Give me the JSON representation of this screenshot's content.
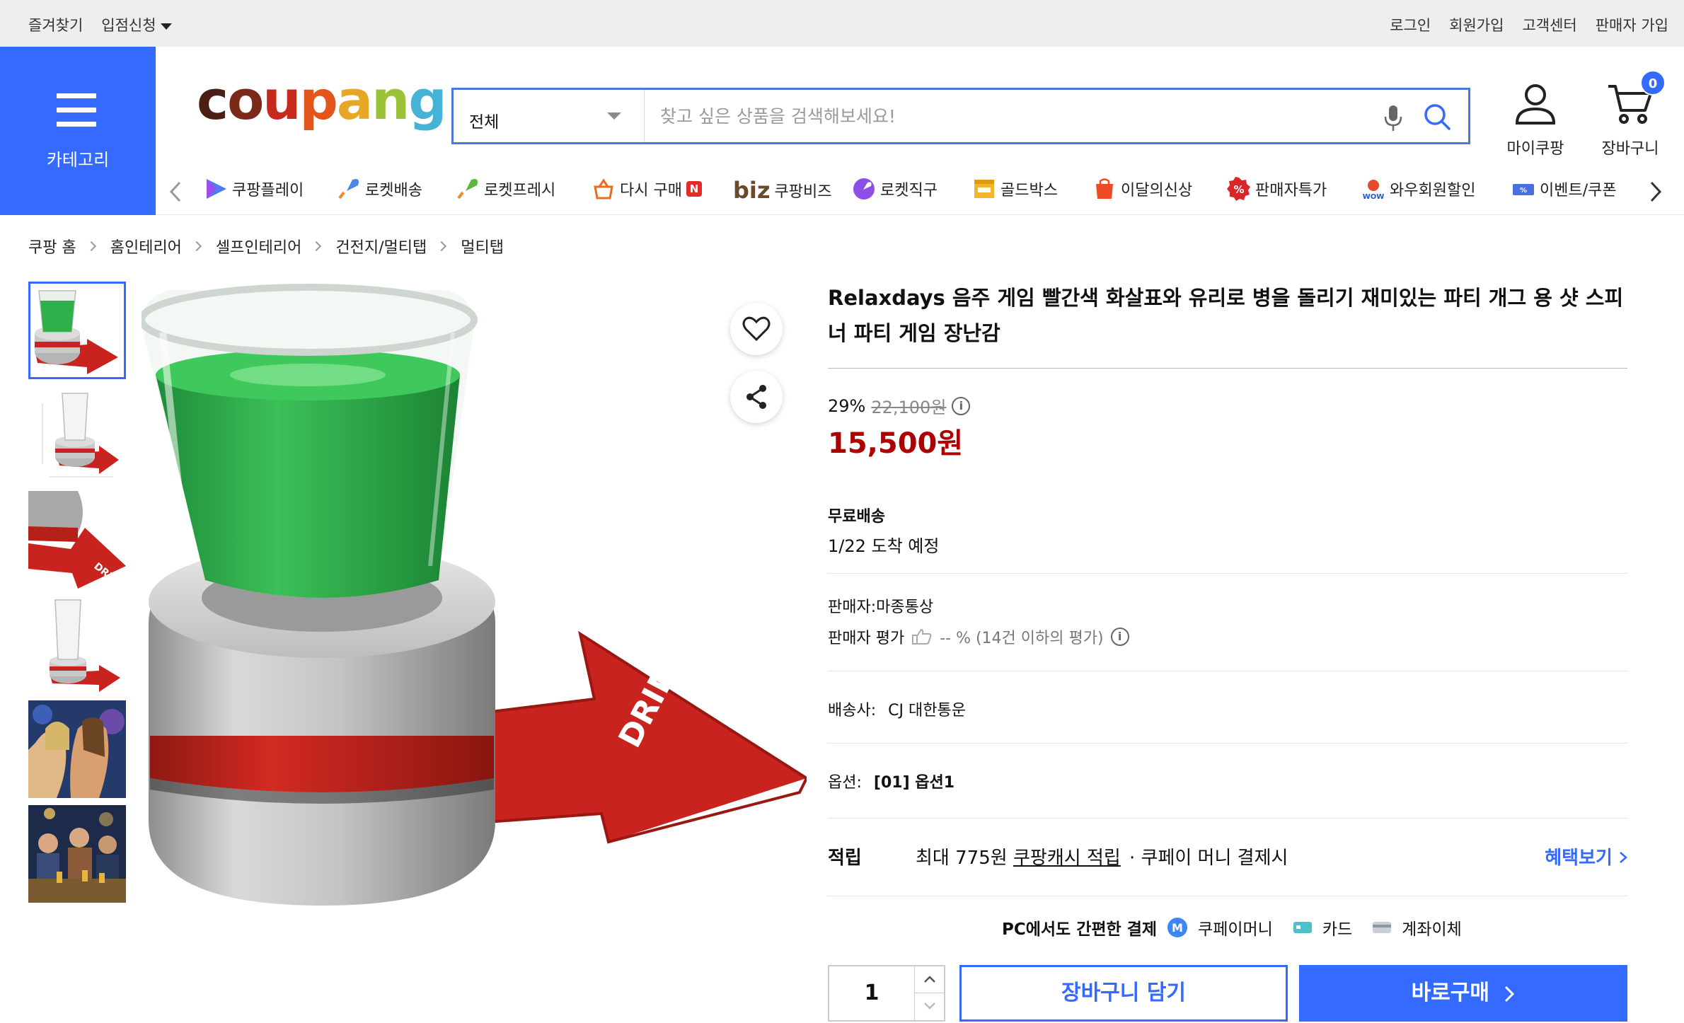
{
  "topbar": {
    "favorites": "즐겨찾기",
    "seller_apply": "입점신청",
    "login": "로그인",
    "signup": "회원가입",
    "customer_center": "고객센터",
    "seller_signup": "판매자 가입"
  },
  "header": {
    "category_label": "카테고리",
    "logo": "coupang",
    "search_scope": "전체",
    "search_placeholder": "찾고 싶은 상품을 검색해보세요!",
    "mycoupang": "마이쿠팡",
    "cart": "장바구니",
    "cart_count": "0"
  },
  "nav": [
    {
      "label": "쿠팡플레이",
      "icon": "play-icon"
    },
    {
      "label": "로켓배송",
      "icon": "rocket-icon"
    },
    {
      "label": "로켓프레시",
      "icon": "rocket-fresh-icon"
    },
    {
      "label": "다시 구매",
      "icon": "rebuy-icon",
      "badge": "N"
    },
    {
      "label": "쿠팡비즈",
      "icon": "biz-icon",
      "prefix": "biz"
    },
    {
      "label": "로켓직구",
      "icon": "rocket-global-icon"
    },
    {
      "label": "골드박스",
      "icon": "goldbox-icon"
    },
    {
      "label": "이달의신상",
      "icon": "new-icon"
    },
    {
      "label": "판매자특가",
      "icon": "percent-icon"
    },
    {
      "label": "와우회원할인",
      "icon": "wow-icon"
    },
    {
      "label": "이벤트/쿠폰",
      "icon": "coupon-icon"
    }
  ],
  "breadcrumb": [
    "쿠팡 홈",
    "홈인테리어",
    "셀프인테리어",
    "건전지/멀티탭",
    "멀티탭"
  ],
  "product": {
    "title": "Relaxdays 음주 게임 빨간색 화살표와 유리로 병을 돌리기 재미있는 파티 개그 용 샷 스피너 파티 게임 장난감",
    "discount_rate": "29%",
    "original_price": "22,100원",
    "price": "15,500원",
    "shipping_title": "무료배송",
    "arrival": "1/22 도착 예정",
    "seller": "판매자:마종통상",
    "seller_rating_label": "판매자 평가",
    "seller_rating_value": "-- % (14건 이하의 평가)",
    "carrier_label": "배송사:",
    "carrier": "CJ 대한통운",
    "option_label": "옵션:",
    "option_value": "[01] 옵션1",
    "reward_label": "적립",
    "reward_text": "최대 775원",
    "reward_link": "쿠팡캐시 적립",
    "reward_suffix": "· 쿠페이 머니 결제시",
    "benefit_link": "혜택보기",
    "pc_pay_title": "PC에서도 간편한 결제",
    "pay_methods": [
      "쿠페이머니",
      "카드",
      "계좌이체"
    ],
    "quantity": "1",
    "add_to_cart": "장바구니 담기",
    "buy_now": "바로구매",
    "image_label": "DRINK"
  },
  "colors": {
    "accent": "#346aff",
    "price_red": "#ae0000",
    "glass_green": "#2fb04a",
    "arrow_red": "#c8231e"
  }
}
